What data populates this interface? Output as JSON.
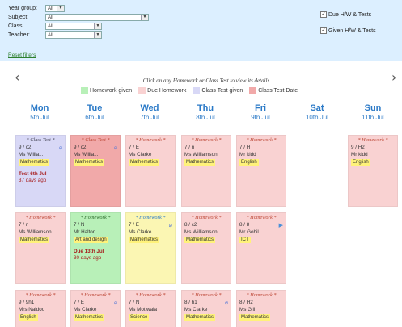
{
  "filters": {
    "year_group": {
      "label": "Year group:",
      "value": "All"
    },
    "subject": {
      "label": "Subject:",
      "value": "All"
    },
    "class": {
      "label": "Class:",
      "value": "All"
    },
    "teacher": {
      "label": "Teacher:",
      "value": "All"
    },
    "reset_label": "Reset filters"
  },
  "toggles": [
    {
      "label": "Due H/W & Tests",
      "checked": true
    },
    {
      "label": "Given H/W & Tests",
      "checked": true
    }
  ],
  "nav": {
    "prev": "‹",
    "next": "›"
  },
  "hint": "Click on any Homework or Class Test to view its details",
  "legend": [
    {
      "label": "Homework given",
      "color": "#b8f0b8"
    },
    {
      "label": "Due Homework",
      "color": "#f9d2d2"
    },
    {
      "label": "Class Test given",
      "color": "#d8d8f6"
    },
    {
      "label": "Class Test Date",
      "color": "#f1a9a9"
    }
  ],
  "days": [
    {
      "name": "Mon",
      "date": "5th Jul"
    },
    {
      "name": "Tue",
      "date": "6th Jul"
    },
    {
      "name": "Wed",
      "date": "7th Jul"
    },
    {
      "name": "Thu",
      "date": "8th Jul"
    },
    {
      "name": "Fri",
      "date": "9th Jul"
    },
    {
      "name": "Sat",
      "date": "10th Jul"
    },
    {
      "name": "Sun",
      "date": "11th Jul"
    }
  ],
  "cards": {
    "r0c0": {
      "type": "* Class Test *",
      "cls": "9 / c2",
      "teacher": "Ms Willia...",
      "subject": "Mathematics",
      "due": "Test 6th Jul",
      "ago": "37 days ago"
    },
    "r0c1": {
      "type": "* Class Test *",
      "cls": "9 / c2",
      "teacher": "Ms Willia...",
      "subject": "Mathematics"
    },
    "r0c2": {
      "type": "* Homework *",
      "cls": "7 / E",
      "teacher": "Ms Clarke",
      "subject": "Mathematics"
    },
    "r0c3": {
      "type": "* Homework *",
      "cls": "7 / n",
      "teacher": "Ms Williamson",
      "subject": "Mathematics"
    },
    "r0c4": {
      "type": "* Homework *",
      "cls": "7 / H",
      "teacher": "Mr kidd",
      "subject": "English"
    },
    "r0c6": {
      "type": "* Homework *",
      "cls": "9 / H2",
      "teacher": "Mr kidd",
      "subject": "English"
    },
    "r1c0": {
      "type": "* Homework *",
      "cls": "7 / n",
      "teacher": "Ms Williamson",
      "subject": "Mathematics"
    },
    "r1c1": {
      "type": "* Homework *",
      "cls": "7 / N",
      "teacher": "Mr Halton",
      "subject": "Art and design",
      "due": "Due 13th Jul",
      "ago": "30 days ago"
    },
    "r1c2": {
      "type": "* Homework *",
      "cls": "7 / E",
      "teacher": "Ms Clarke",
      "subject": "Mathematics"
    },
    "r1c3": {
      "type": "* Homework *",
      "cls": "8 / c2",
      "teacher": "Ms Williamson",
      "subject": "Mathematics"
    },
    "r1c4": {
      "type": "* Homework *",
      "cls": "8 / 8",
      "teacher": "Mr Gohil",
      "subject": "ICT"
    },
    "r2c0": {
      "type": "* Homework *",
      "cls": "9 / 9h1",
      "teacher": "Mrs Naidoo",
      "subject": "English"
    },
    "r2c1": {
      "type": "* Homework *",
      "cls": "7 / E",
      "teacher": "Ms Clarke",
      "subject": "Mathematics"
    },
    "r2c2": {
      "type": "* Homework *",
      "cls": "7 / N",
      "teacher": "Ms Motiwala",
      "subject": "Science"
    },
    "r2c3": {
      "type": "* Homework *",
      "cls": "8 / h1",
      "teacher": "Ms Clarke",
      "subject": "Mathematics"
    },
    "r2c4": {
      "type": "* Homework *",
      "cls": "8 / H2",
      "teacher": "Ms Gill",
      "subject": "Mathematics"
    }
  }
}
